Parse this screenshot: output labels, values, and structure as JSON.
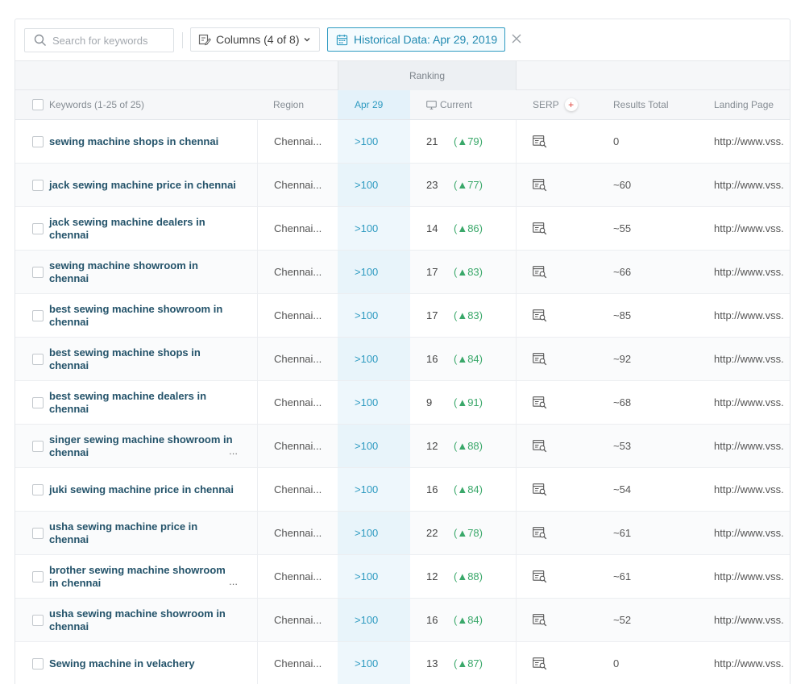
{
  "toolbar": {
    "search_placeholder": "Search for keywords",
    "search_icon": "search-icon",
    "columns_label": "Columns (4 of 8)",
    "columns_icon": "edit-columns-icon",
    "historical_label": "Historical Data: Apr 29, 2019",
    "historical_icon": "calendar-icon",
    "close_icon": "close-icon"
  },
  "table": {
    "group_header": "Ranking",
    "headers": {
      "keywords": "Keywords (1-25 of 25)",
      "region": "Region",
      "apr": "Apr 29",
      "current": "Current",
      "serp": "SERP",
      "serp_plus": "+",
      "results_total": "Results Total",
      "landing_page": "Landing Page"
    },
    "rows": [
      {
        "keyword": "sewing machine shops in chennai",
        "more": "",
        "region": "Chennai...",
        "apr": ">100",
        "current": "21",
        "delta": "(▲79)",
        "total": "0",
        "landing": "http://www.vss."
      },
      {
        "keyword": "jack sewing machine price in chennai",
        "more": "",
        "region": "Chennai...",
        "apr": ">100",
        "current": "23",
        "delta": "(▲77)",
        "total": "~60",
        "landing": "http://www.vss."
      },
      {
        "keyword": "jack sewing machine dealers in chennai",
        "more": "",
        "region": "Chennai...",
        "apr": ">100",
        "current": "14",
        "delta": "(▲86)",
        "total": "~55",
        "landing": "http://www.vss."
      },
      {
        "keyword": "sewing machine showroom in chennai",
        "more": "",
        "region": "Chennai...",
        "apr": ">100",
        "current": "17",
        "delta": "(▲83)",
        "total": "~66",
        "landing": "http://www.vss."
      },
      {
        "keyword": "best sewing machine showroom in chennai",
        "more": "",
        "region": "Chennai...",
        "apr": ">100",
        "current": "17",
        "delta": "(▲83)",
        "total": "~85",
        "landing": "http://www.vss."
      },
      {
        "keyword": "best sewing machine shops in chennai",
        "more": "",
        "region": "Chennai...",
        "apr": ">100",
        "current": "16",
        "delta": "(▲84)",
        "total": "~92",
        "landing": "http://www.vss."
      },
      {
        "keyword": "best sewing machine dealers in chennai",
        "more": "",
        "region": "Chennai...",
        "apr": ">100",
        "current": "9",
        "delta": "(▲91)",
        "total": "~68",
        "landing": "http://www.vss."
      },
      {
        "keyword": "singer sewing machine showroom in chennai",
        "more": "...",
        "region": "Chennai...",
        "apr": ">100",
        "current": "12",
        "delta": "(▲88)",
        "total": "~53",
        "landing": "http://www.vss."
      },
      {
        "keyword": "juki sewing machine price in chennai",
        "more": "",
        "region": "Chennai...",
        "apr": ">100",
        "current": "16",
        "delta": "(▲84)",
        "total": "~54",
        "landing": "http://www.vss."
      },
      {
        "keyword": "usha sewing machine price in chennai",
        "more": "",
        "region": "Chennai...",
        "apr": ">100",
        "current": "22",
        "delta": "(▲78)",
        "total": "~61",
        "landing": "http://www.vss."
      },
      {
        "keyword": "brother sewing machine showroom in chennai",
        "more": "...",
        "region": "Chennai...",
        "apr": ">100",
        "current": "12",
        "delta": "(▲88)",
        "total": "~61",
        "landing": "http://www.vss."
      },
      {
        "keyword": "usha sewing machine showroom in chennai",
        "more": "",
        "region": "Chennai...",
        "apr": ">100",
        "current": "16",
        "delta": "(▲84)",
        "total": "~52",
        "landing": "http://www.vss."
      },
      {
        "keyword": "Sewing machine in velachery",
        "more": "",
        "region": "Chennai...",
        "apr": ">100",
        "current": "13",
        "delta": "(▲87)",
        "total": "0",
        "landing": "http://www.vss."
      }
    ]
  },
  "colors": {
    "accent": "#2f9bc1",
    "keyword": "#24536a",
    "positive": "#3aa86a",
    "serp_plus": "#e0463f"
  }
}
